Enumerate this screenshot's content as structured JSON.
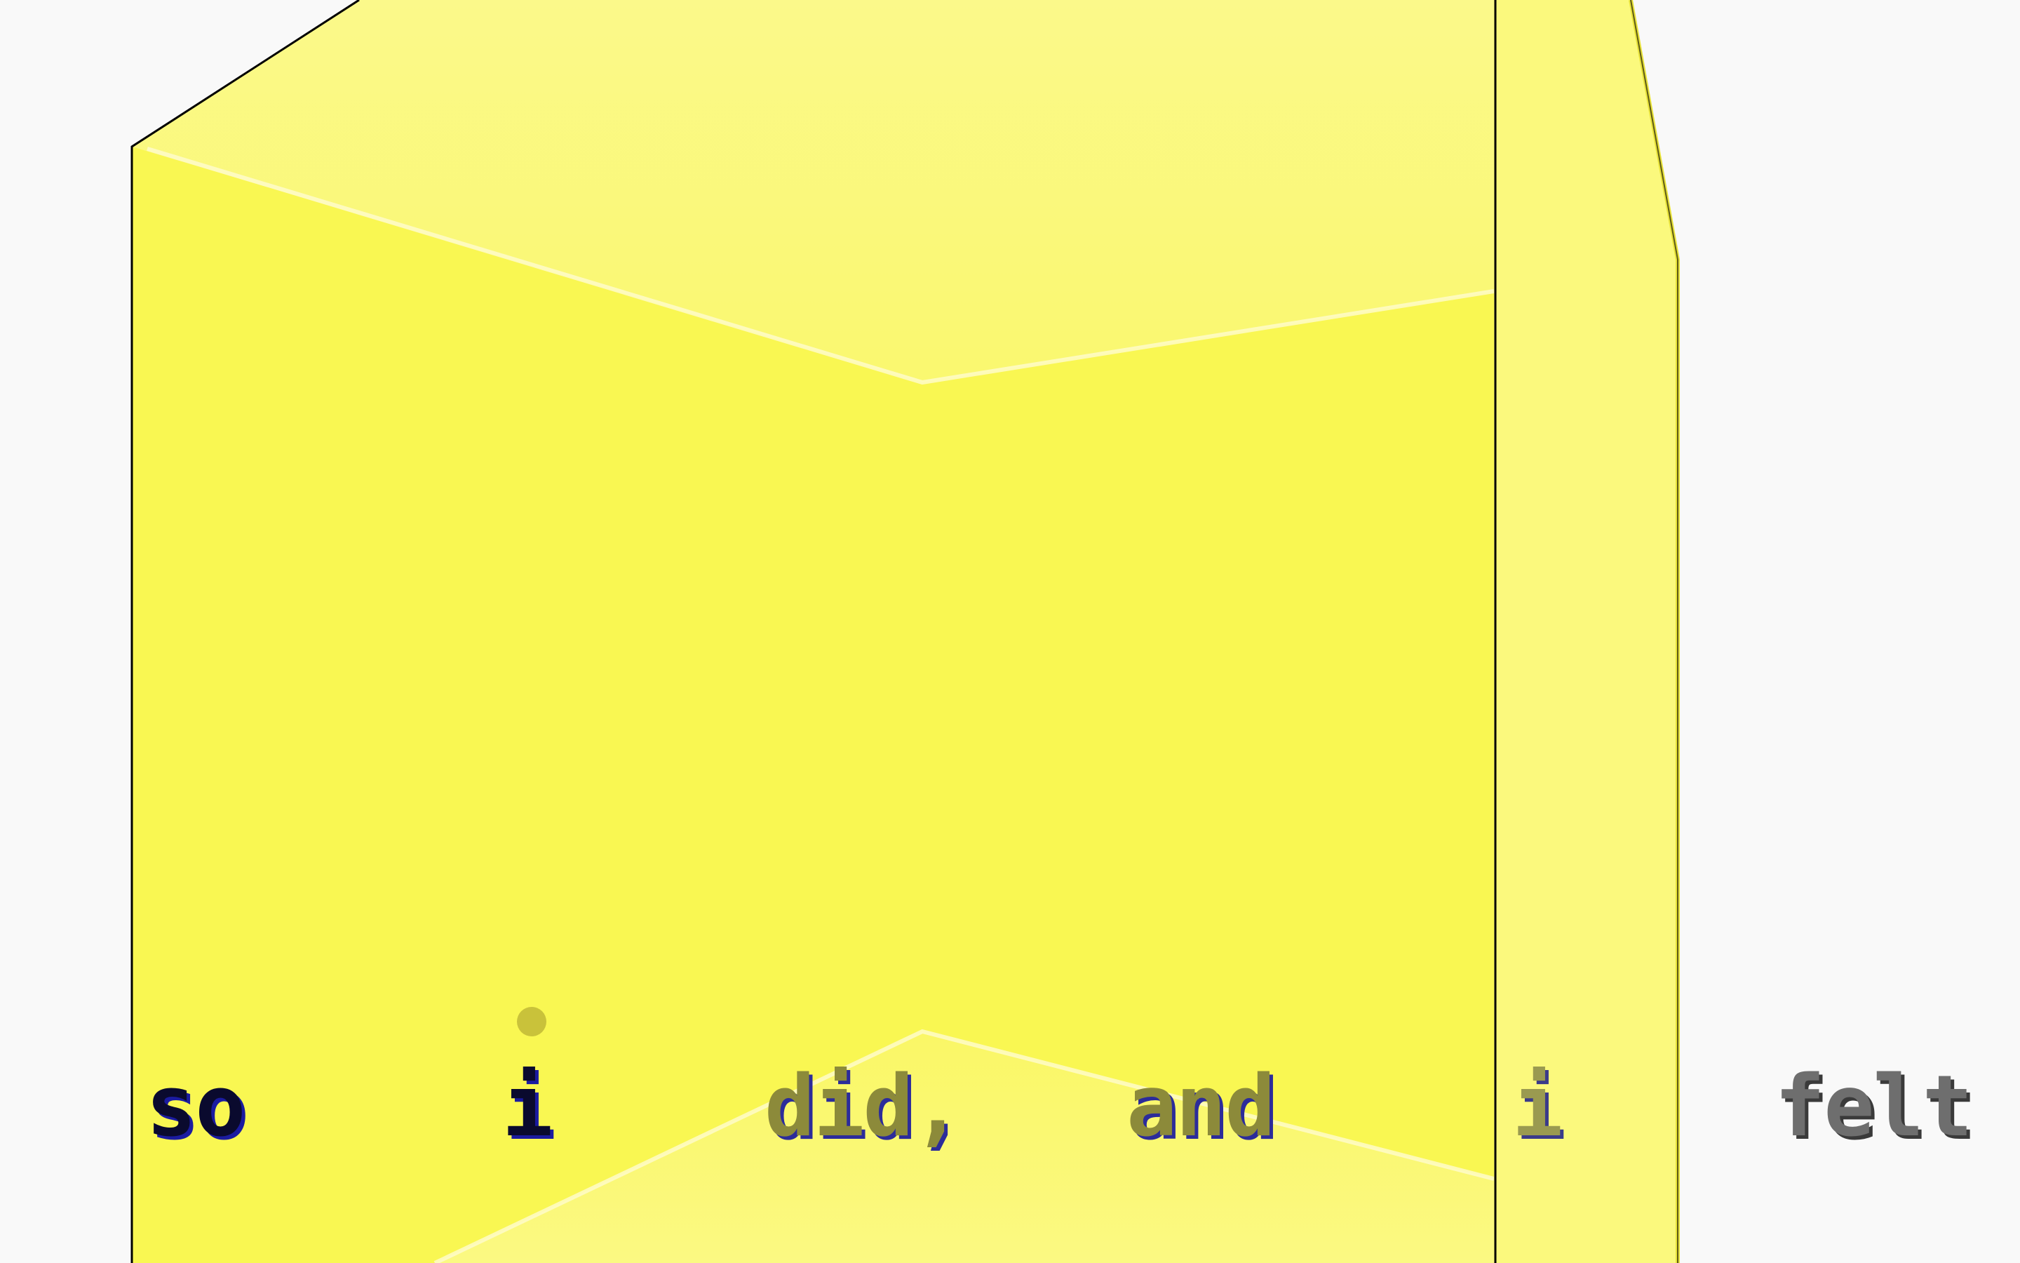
{
  "subtitle": {
    "words": [
      "so",
      "i",
      "did,",
      "and",
      "i",
      "felt"
    ],
    "active_word_index": 1
  },
  "colors": {
    "background": "#f9f9f9",
    "prism_face": "#f9f752",
    "prism_face_light": "#fbf979",
    "prism_edge": "#000000",
    "bounce_dot": "#c9c23a"
  }
}
